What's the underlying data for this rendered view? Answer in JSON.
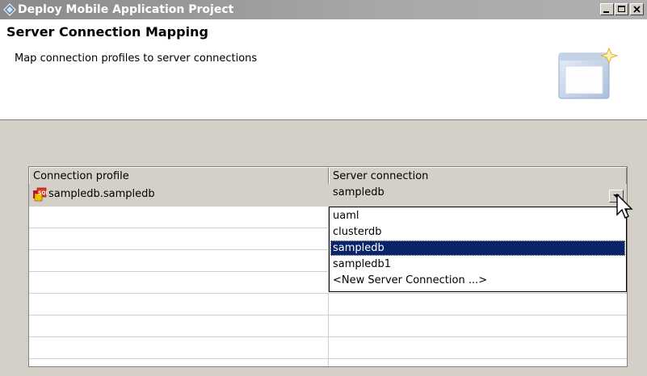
{
  "window": {
    "title": "Deploy Mobile Application Project",
    "buttons": [
      "minimize-icon",
      "maximize-icon",
      "close-icon"
    ]
  },
  "banner": {
    "heading": "Server Connection Mapping",
    "description": "Map connection profiles to server connections"
  },
  "table": {
    "columns": [
      "Connection profile",
      "Server connection"
    ],
    "rows": [
      {
        "profile": "sampledb.sampledb",
        "server_connection": "sampledb",
        "icon": "database-profile-icon"
      }
    ]
  },
  "dropdown": {
    "options": [
      "uaml",
      "clusterdb",
      "sampledb",
      "sampledb1",
      "<New Server Connection ...>"
    ],
    "selected": "sampledb"
  },
  "colors": {
    "title_bar": "#9a9a9a",
    "selection": "#0a246a",
    "dialog_bg": "#d4d0c8"
  }
}
